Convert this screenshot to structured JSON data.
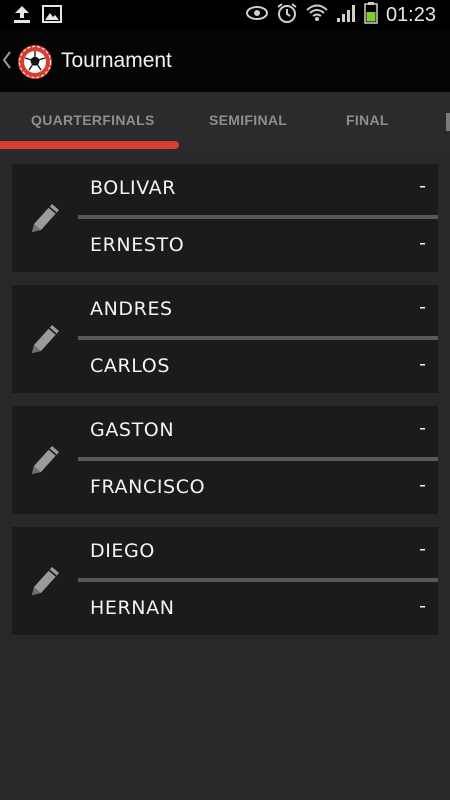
{
  "status_bar": {
    "time": "01:23",
    "icons": [
      "upload-icon",
      "image-icon",
      "eye-icon",
      "alarm-icon",
      "wifi-icon",
      "signal-icon",
      "battery-icon"
    ]
  },
  "action_bar": {
    "title": "Tournament",
    "icons": [
      "back-chevron-icon",
      "soccer-ball-logo-icon"
    ]
  },
  "tabs": [
    {
      "label": "QUARTERFINALS",
      "active": true
    },
    {
      "label": "SEMIFINAL",
      "active": false
    },
    {
      "label": "FINAL",
      "active": false
    }
  ],
  "matches": [
    {
      "player1": {
        "name": "BOLIVAR",
        "score": "-"
      },
      "player2": {
        "name": "ERNESTO",
        "score": "-"
      }
    },
    {
      "player1": {
        "name": "ANDRES",
        "score": "-"
      },
      "player2": {
        "name": "CARLOS",
        "score": "-"
      }
    },
    {
      "player1": {
        "name": "GASTON",
        "score": "-"
      },
      "player2": {
        "name": "FRANCISCO",
        "score": "-"
      }
    },
    {
      "player1": {
        "name": "DIEGO",
        "score": "-"
      },
      "player2": {
        "name": "HERNAN",
        "score": "-"
      }
    }
  ],
  "colors": {
    "accent": "#d7402e",
    "background": "#28282a",
    "card": "#1b1b1d",
    "tab_text": "#8e8e90",
    "battery": "#7fcf2a"
  }
}
